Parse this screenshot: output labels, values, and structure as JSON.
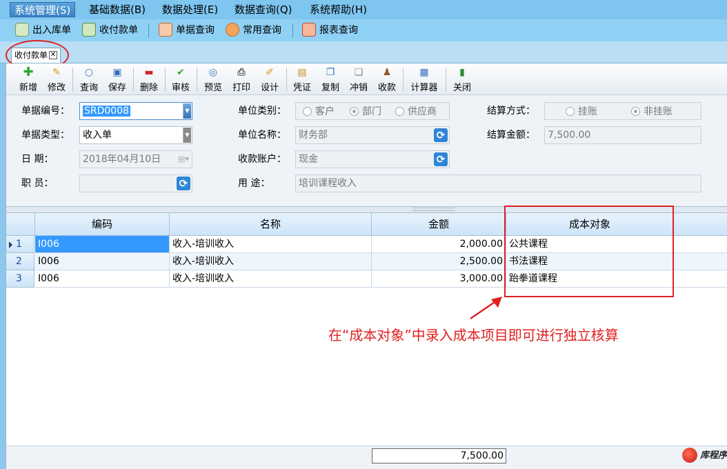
{
  "menu": [
    {
      "label": "系统管理(S)",
      "active": true
    },
    {
      "label": "基础数据(B)"
    },
    {
      "label": "数据处理(E)"
    },
    {
      "label": "数据查询(Q)"
    },
    {
      "label": "系统帮助(H)"
    }
  ],
  "quickbar": [
    {
      "label": "出入库单",
      "icon": "stock-io-icon"
    },
    {
      "label": "收付款单",
      "icon": "payment-icon"
    },
    {
      "label": "单据查询",
      "icon": "doc-query-icon"
    },
    {
      "label": "常用查询",
      "icon": "chart-query-icon"
    },
    {
      "label": "报表查询",
      "icon": "report-query-icon"
    }
  ],
  "tab": {
    "label": "收付款单",
    "close": "✕"
  },
  "toolbar": [
    {
      "label": "新增",
      "icon": "add-icon"
    },
    {
      "label": "修改",
      "icon": "edit-icon"
    },
    {
      "label": "查询",
      "icon": "search-icon"
    },
    {
      "label": "保存",
      "icon": "save-icon"
    },
    {
      "label": "删除",
      "icon": "delete-icon"
    },
    {
      "label": "审核",
      "icon": "approve-icon"
    },
    {
      "label": "预览",
      "icon": "preview-icon"
    },
    {
      "label": "打印",
      "icon": "print-icon"
    },
    {
      "label": "设计",
      "icon": "design-icon"
    },
    {
      "label": "凭证",
      "icon": "voucher-icon"
    },
    {
      "label": "复制",
      "icon": "copy-icon"
    },
    {
      "label": "冲销",
      "icon": "reverse-icon"
    },
    {
      "label": "收款",
      "icon": "receive-icon"
    },
    {
      "label": "计算器",
      "icon": "calculator-icon"
    },
    {
      "label": "关闭",
      "icon": "close-door-icon"
    }
  ],
  "form": {
    "doc_no": {
      "label": "单据编号：",
      "value": "SRD0008"
    },
    "doc_type": {
      "label": "单据类型：",
      "value": "收入单"
    },
    "date": {
      "label": "日    期：",
      "value": "2018年04月10日"
    },
    "staff": {
      "label": "职    员：",
      "value": ""
    },
    "unit_category": {
      "label": "单位类别：",
      "options": [
        "客户",
        "部门",
        "供应商"
      ],
      "selected": "部门"
    },
    "unit_name": {
      "label": "单位名称：",
      "value": "财务部"
    },
    "account": {
      "label": "收款账户：",
      "value": "现金"
    },
    "purpose": {
      "label": "用    途：",
      "value": "培训课程收入"
    },
    "settle_method": {
      "label": "结算方式：",
      "options": [
        "挂账",
        "非挂账"
      ],
      "selected": "非挂账"
    },
    "settle_amount": {
      "label": "结算金额：",
      "value": "7,500.00"
    }
  },
  "grid": {
    "columns": [
      "编码",
      "名称",
      "金额",
      "成本对象"
    ],
    "rows": [
      {
        "no": "1",
        "code": "I006",
        "name": "收入-培训收入",
        "amount": "2,000.00",
        "cost_object": "公共课程"
      },
      {
        "no": "2",
        "code": "I006",
        "name": "收入-培训收入",
        "amount": "2,500.00",
        "cost_object": "书法课程"
      },
      {
        "no": "3",
        "code": "I006",
        "name": "收入-培训收入",
        "amount": "3,000.00",
        "cost_object": "跆拳道课程"
      }
    ],
    "total": "7,500.00"
  },
  "annotation": "在“成本对象”中录入成本项目即可进行独立核算",
  "watermark": "库程序",
  "colors": {
    "menu_bg": "#7ec5f0",
    "accent_red": "#e02020",
    "selection": "#3399ff"
  }
}
